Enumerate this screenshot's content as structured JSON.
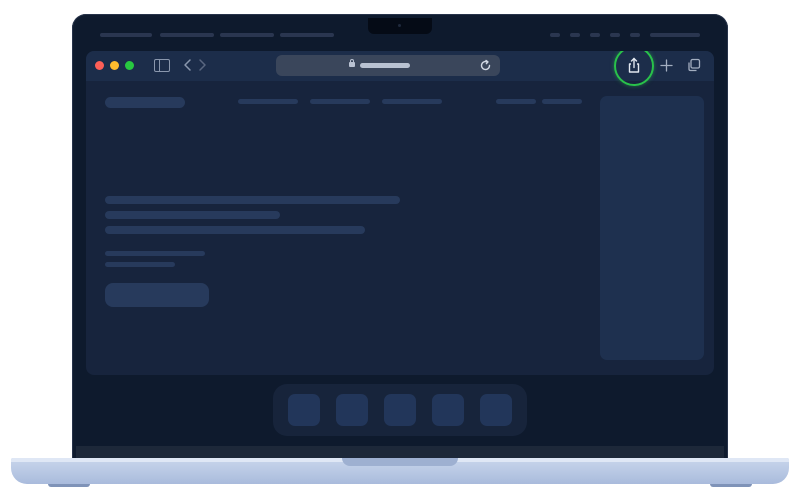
{
  "device": {
    "type": "laptop",
    "accent_color": "#29c24a",
    "screen_color": "#0e1a2d",
    "window_color": "#17243d"
  },
  "browser": {
    "traffic_lights": [
      "close",
      "minimize",
      "maximize"
    ],
    "toolbar_icons": [
      "sidebar-icon",
      "back-arrow-icon",
      "forward-arrow-icon",
      "lock-icon",
      "reload-icon",
      "share-icon",
      "plus-icon",
      "tabs-icon"
    ],
    "highlighted_control": "share-button"
  },
  "dock": {
    "item_count": 5
  }
}
